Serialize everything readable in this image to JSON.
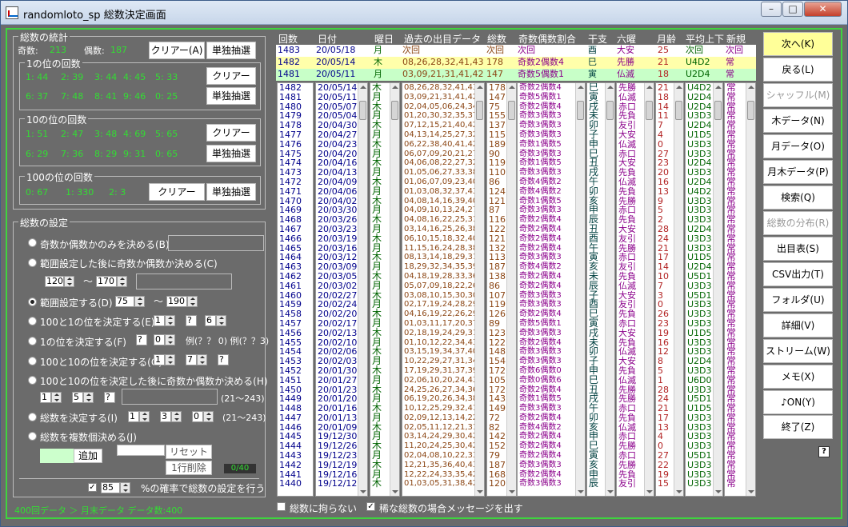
{
  "window": {
    "title": "randomloto_sp  総数決定画面"
  },
  "stats": {
    "group_title": "総数の統計",
    "odd_label": "奇数:",
    "odd_value": "213",
    "even_label": "偶数:",
    "even_value": "187",
    "clear_a": "クリアー(A)",
    "solo_draw": "単独抽選",
    "ones_title": "1の位の回数",
    "ones_row1": [
      "1: 44",
      "2: 39",
      "3: 44",
      "4: 45",
      "5: 33"
    ],
    "ones_row2": [
      "6: 37",
      "7: 48",
      "8: 41",
      "9: 46",
      "0: 25"
    ],
    "tens_title": "10の位の回数",
    "tens_row1": [
      "1: 51",
      "2: 47",
      "3: 48",
      "4: 69",
      "5: 65"
    ],
    "tens_row2": [
      "6: 29",
      "7: 36",
      "8: 29",
      "9: 31",
      "0: 65"
    ],
    "hund_title": "100の位の回数",
    "hund_row": [
      "0: 67",
      "1: 330",
      "2: 3"
    ],
    "clear": "クリアー",
    "clear2": "クリアー"
  },
  "settings": {
    "group_title": "総数の設定",
    "opt1": "奇数か偶数かのみを決める(B)",
    "opt2": "範囲設定した後に奇数か偶数か決める(C)",
    "range2_from": "120",
    "range2_to": "170",
    "tilde": "～",
    "opt3": "範囲設定する(D)",
    "range3_from": "75",
    "range3_to": "190",
    "opt4": "100と1の位を決定する(E)",
    "opt4_a": "1",
    "opt4_b": "?",
    "opt4_c": "6",
    "opt5": "1の位を決定する(F)",
    "opt5_a": "?",
    "opt5_b": "0",
    "opt5_ex": "例(？？ 0)  例(？？3)",
    "opt6": "100と10の位を決定する(G)",
    "opt6_a": "1",
    "opt6_b": "7",
    "opt6_c": "?",
    "opt7": "100と10の位を決定した後に奇数か偶数か決める(H)",
    "opt7_a": "1",
    "opt7_b": "5",
    "opt7_c": "?",
    "opt7_range": "(21～243)",
    "opt8": "総数を決定する(I)",
    "opt8_a": "1",
    "opt8_b": "3",
    "opt8_c": "0",
    "opt8_range": "(21～243)",
    "opt9": "総数を複数個決める(J)",
    "add": "追加",
    "reset": "リセット",
    "delete_row": "1行削除",
    "count": "0/40",
    "prob_value": "85",
    "prob_label": "%の確率で総数の設定を行う"
  },
  "status": "400回データ ＞ 月末データ  データ数:400",
  "headers": [
    "回数",
    "日付",
    "曜日",
    "過去の出目データ",
    "総数",
    "奇数偶数割合",
    "干支",
    "六曜",
    "月齢",
    "平均上下",
    "新規"
  ],
  "top_rows": [
    {
      "no": "1483",
      "date": "20/05/18",
      "day": "月",
      "data": "次回",
      "sum": "次回",
      "ratio": "次回",
      "eto": "酉",
      "rokuyo": "大安",
      "moon": "25",
      "avg": "次回",
      "new": "次回",
      "bg": "#ffffff"
    },
    {
      "no": "1482",
      "date": "20/05/14",
      "day": "木",
      "data": "08,26,28,32,41,43",
      "sum": "178",
      "ratio": "奇数2偶数4",
      "eto": "巳",
      "rokuyo": "先勝",
      "moon": "21",
      "avg": "U4D2",
      "new": "常",
      "bg": "#ffffaa"
    },
    {
      "no": "1481",
      "date": "20/05/11",
      "day": "月",
      "data": "03,09,21,31,41,42",
      "sum": "147",
      "ratio": "奇数5偶数1",
      "eto": "寅",
      "rokuyo": "仏滅",
      "moon": "18",
      "avg": "U2D4",
      "new": "常",
      "bg": "#c8ffc8"
    }
  ],
  "list": {
    "no": [
      "1482",
      "1481",
      "1480",
      "1479",
      "1478",
      "1477",
      "1476",
      "1475",
      "1474",
      "1473",
      "1472",
      "1471",
      "1470",
      "1469",
      "1468",
      "1467",
      "1466",
      "1465",
      "1464",
      "1463",
      "1462",
      "1461",
      "1460",
      "1459",
      "1458",
      "1457",
      "1456",
      "1455",
      "1454",
      "1453",
      "1452",
      "1451",
      "1450",
      "1449",
      "1448",
      "1447",
      "1446",
      "1445",
      "1444",
      "1443",
      "1442",
      "1441",
      "1440"
    ],
    "date": [
      "20/05/14",
      "20/05/11",
      "20/05/07",
      "20/05/04",
      "20/04/30",
      "20/04/27",
      "20/04/23",
      "20/04/20",
      "20/04/16",
      "20/04/13",
      "20/04/09",
      "20/04/06",
      "20/04/02",
      "20/03/30",
      "20/03/26",
      "20/03/23",
      "20/03/19",
      "20/03/16",
      "20/03/12",
      "20/03/09",
      "20/03/05",
      "20/03/02",
      "20/02/27",
      "20/02/24",
      "20/02/20",
      "20/02/17",
      "20/02/13",
      "20/02/10",
      "20/02/06",
      "20/02/03",
      "20/01/30",
      "20/01/27",
      "20/01/23",
      "20/01/20",
      "20/01/16",
      "20/01/13",
      "20/01/09",
      "19/12/30",
      "19/12/26",
      "19/12/23",
      "19/12/19",
      "19/12/16",
      "19/12/12"
    ],
    "day": [
      "木",
      "月",
      "木",
      "月",
      "木",
      "月",
      "木",
      "月",
      "木",
      "月",
      "木",
      "月",
      "木",
      "月",
      "木",
      "月",
      "木",
      "月",
      "木",
      "月",
      "木",
      "月",
      "木",
      "月",
      "木",
      "月",
      "木",
      "月",
      "木",
      "月",
      "木",
      "月",
      "木",
      "月",
      "木",
      "月",
      "木",
      "月",
      "木",
      "月",
      "木",
      "月",
      "木"
    ],
    "data": [
      "08,26,28,32,41,43",
      "03,09,21,31,41,42",
      "02,04,05,06,24,34",
      "01,20,30,32,35,37",
      "07,12,15,21,40,42",
      "04,13,14,25,27,32",
      "06,22,38,40,41,42",
      "06,07,09,20,21,27",
      "04,06,08,22,27,32",
      "01,05,06,27,33,38",
      "01,06,07,09,23,40",
      "01,03,08,32,37,43",
      "04,08,14,16,39,40",
      "04,09,10,13,24,27",
      "04,08,16,22,25,31",
      "03,14,16,25,26,38",
      "06,10,15,18,32,40",
      "11,15,16,24,28,38",
      "08,13,14,18,29,31",
      "18,29,32,34,35,39",
      "04,18,19,28,33,36",
      "05,07,09,18,22,26",
      "03,08,10,15,30,30",
      "02,17,19,24,28,29",
      "04,16,19,22,26,29",
      "01,03,11,17,20,37",
      "02,18,19,24,29,31",
      "01,10,12,22,34,43",
      "03,15,19,34,37,40",
      "10,22,29,27,31,34",
      "17,19,29,31,37,39",
      "02,06,10,20,24,43",
      "24,25,26,27,34,36",
      "06,19,20,26,34,38",
      "10,12,25,29,32,41",
      "02,09,12,13,14,22",
      "02,05,11,12,21,31",
      "03,14,24,29,30,42",
      "11,20,24,25,30,42",
      "02,04,08,10,22,33",
      "12,21,35,36,40,43",
      "12,22,24,33,35,42",
      "01,03,05,31,38,42"
    ],
    "sum": [
      "178",
      "147",
      "75",
      "155",
      "137",
      "115",
      "189",
      "90",
      "119",
      "110",
      "86",
      "124",
      "121",
      "87",
      "116",
      "122",
      "121",
      "132",
      "113",
      "187",
      "138",
      "86",
      "107",
      "119",
      "126",
      "89",
      "123",
      "122",
      "148",
      "154",
      "172",
      "105",
      "172",
      "143",
      "149",
      "72",
      "82",
      "142",
      "152",
      "79",
      "187",
      "168",
      "120"
    ],
    "ratio": [
      "奇数2偶数4",
      "奇数5偶数1",
      "奇数2偶数4",
      "奇数3偶数3",
      "奇数3偶数3",
      "奇数3偶数3",
      "奇数1偶数5",
      "奇数3偶数3",
      "奇数1偶数5",
      "奇数3偶数3",
      "奇数4偶数2",
      "奇数4偶数2",
      "奇数1偶数5",
      "奇数3偶数3",
      "奇数2偶数4",
      "奇数2偶数4",
      "奇数2偶数4",
      "奇数2偶数4",
      "奇数3偶数3",
      "奇数4偶数2",
      "奇数2偶数4",
      "奇数2偶数4",
      "奇数3偶数3",
      "奇数3偶数3",
      "奇数2偶数4",
      "奇数5偶数1",
      "奇数3偶数3",
      "奇数2偶数4",
      "奇数3偶数3",
      "奇数3偶数3",
      "奇数6偶数0",
      "奇数0偶数6",
      "奇数2偶数4",
      "奇数1偶数5",
      "奇数3偶数3",
      "奇数2偶数4",
      "奇数4偶数2",
      "奇数2偶数4",
      "奇数2偶数4",
      "奇数2偶数4",
      "奇数3偶数3",
      "奇数2偶数4",
      "奇数3偶数3"
    ],
    "eto": [
      "巳",
      "寅",
      "戌",
      "未",
      "卯",
      "子",
      "申",
      "巳",
      "丑",
      "戌",
      "午",
      "卯",
      "亥",
      "申",
      "辰",
      "丑",
      "酉",
      "午",
      "寅",
      "亥",
      "未",
      "辰",
      "子",
      "酉",
      "巳",
      "寅",
      "戌",
      "未",
      "卯",
      "子",
      "申",
      "巳",
      "丑",
      "戌",
      "午",
      "卯",
      "亥",
      "申",
      "巳",
      "寅",
      "亥",
      "申",
      "辰"
    ],
    "rokuyo": [
      "先勝",
      "仏滅",
      "赤口",
      "先負",
      "友引",
      "大安",
      "仏滅",
      "赤口",
      "大安",
      "先負",
      "仏滅",
      "先負",
      "先勝",
      "赤口",
      "先負",
      "大安",
      "友引",
      "先勝",
      "赤口",
      "友引",
      "先負",
      "仏滅",
      "大安",
      "友引",
      "先負",
      "赤口",
      "大安",
      "先負",
      "仏滅",
      "大安",
      "先負",
      "仏滅",
      "先勝",
      "先勝",
      "赤口",
      "先負",
      "仏滅",
      "赤口",
      "先勝",
      "赤口",
      "先勝",
      "先負",
      "友引"
    ],
    "moon": [
      "21",
      "18",
      "14",
      "11",
      "7",
      "4",
      "0",
      "27",
      "23",
      "20",
      "16",
      "13",
      "9",
      "5",
      "2",
      "28",
      "24",
      "21",
      "17",
      "14",
      "10",
      "7",
      "3",
      "0",
      "26",
      "23",
      "19",
      "16",
      "12",
      "8",
      "5",
      "1",
      "28",
      "24",
      "21",
      "17",
      "13",
      "4",
      "0",
      "27",
      "22",
      "19",
      "15"
    ],
    "avg": [
      "U4D2",
      "U2D4",
      "U2D4",
      "U3D3",
      "U2D4",
      "U1D5",
      "U3D3",
      "U3D3",
      "U2D4",
      "U3D3",
      "U2D4",
      "U4D2",
      "U3D3",
      "U3D3",
      "U3D3",
      "U2D4",
      "U3D3",
      "U3D3",
      "U1D5",
      "U2D4",
      "U5D1",
      "U3D3",
      "U5D1",
      "U3D3",
      "U3D3",
      "U3D3",
      "U1D5",
      "U3D3",
      "U3D3",
      "U2D4",
      "U3D3",
      "U6D0",
      "U3D3",
      "U5D1",
      "U1D5",
      "U3D3",
      "U3D3",
      "U3D3",
      "U3D3",
      "U5D1",
      "U3D3",
      "U3D3",
      "U3D3"
    ],
    "new": [
      "常",
      "常",
      "常",
      "常",
      "常",
      "常",
      "常",
      "常",
      "常",
      "常",
      "常",
      "常",
      "常",
      "常",
      "常",
      "常",
      "常",
      "常",
      "常",
      "常",
      "常",
      "常",
      "常",
      "常",
      "常",
      "常",
      "常",
      "常",
      "常",
      "常",
      "常",
      "常",
      "常",
      "常",
      "常",
      "常",
      "常",
      "常",
      "常",
      "常",
      "常",
      "常",
      "常"
    ]
  },
  "bottom": {
    "chk1": "総数に拘らない",
    "chk2": "稀な総数の場合メッセージを出す"
  },
  "right_buttons": [
    "次へ(K)",
    "戻る(L)",
    "シャッフル(M)",
    "木データ(N)",
    "月データ(O)",
    "月木データ(P)",
    "検索(Q)",
    "総数の分布(R)",
    "出目表(S)",
    "CSV出力(T)",
    "フォルダ(U)",
    "詳細(V)",
    "ストリーム(W)",
    "メモ(X)",
    "♪ON(Y)",
    "終了(Z)"
  ],
  "colors": {
    "green": "#33dd33",
    "accent_frame": "#3fd43f",
    "bg": "#6b6b6b"
  }
}
